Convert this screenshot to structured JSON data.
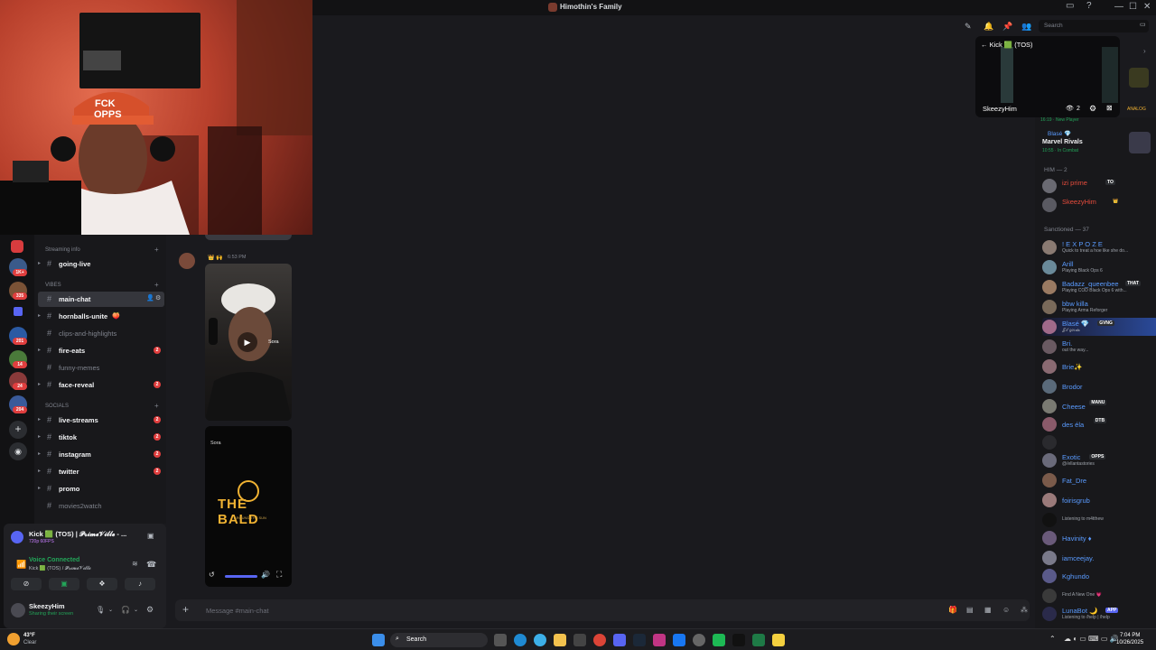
{
  "window": {
    "title": "Himothin's Family",
    "min": "—",
    "max": "☐",
    "close": "✕"
  },
  "server_badges": [
    "1K+",
    "335",
    "201",
    "14",
    "24",
    "204"
  ],
  "channels": {
    "categories": {
      "streaming_info": "Streaming info",
      "vibes": "VIBES",
      "socials": "SOCIALS"
    },
    "items": [
      {
        "name": "going-live",
        "muted": false,
        "badge": ""
      },
      {
        "name": "main-chat",
        "muted": false,
        "badge": ""
      },
      {
        "name": "hornballs-unite",
        "muted": false,
        "badge": ""
      },
      {
        "name": "clips-and-highlights",
        "muted": true,
        "badge": ""
      },
      {
        "name": "fire-eats",
        "muted": false,
        "badge": "2"
      },
      {
        "name": "funny-memes",
        "muted": true,
        "badge": ""
      },
      {
        "name": "face-reveal",
        "muted": false,
        "badge": "2"
      },
      {
        "name": "live-streams",
        "muted": false,
        "badge": "2"
      },
      {
        "name": "tiktok",
        "muted": false,
        "badge": "2"
      },
      {
        "name": "instagram",
        "muted": false,
        "badge": "2"
      },
      {
        "name": "twitter",
        "muted": false,
        "badge": "2"
      },
      {
        "name": "promo",
        "muted": false,
        "badge": ""
      },
      {
        "name": "movies2watch",
        "muted": true,
        "badge": ""
      }
    ]
  },
  "voice": {
    "channel": "Kick 🟩 (TOS) | 𝓟𝓻𝓲𝓶𝓮𝓥𝓲𝓵𝓵𝓮 - ...",
    "sub": "720p 60FPS",
    "status": "Voice Connected",
    "status_sub": "Kick 🟩 (TOS) / 𝓟𝓻𝓲𝓶𝓮𝓥𝓲𝓵𝓵𝓮",
    "user": "SkeezyHim",
    "user_status": "Sharing their screen"
  },
  "chat": {
    "timestamp": "6:53 PM",
    "sora_label": "Sora",
    "sora_label2": "Sora",
    "the_bald": "THE BALD",
    "bald_sub": "AROUND THE SUN",
    "placeholder": "Message #main-chat",
    "plus": "+"
  },
  "header": {
    "search_placeholder": "Search"
  },
  "preview": {
    "title": "Kick 🟩 (TOS)",
    "user": "SkeezyHim",
    "viewers": "2"
  },
  "members": {
    "partial_status": "16:19 · New Player",
    "blase_top": {
      "name": "Blasé 💎",
      "game": "Marvel Rivals",
      "status": "10:55 · In Combat"
    },
    "him_group": "HIM — 2",
    "him": [
      {
        "name": "izi prime",
        "color": "#e74c3c",
        "tag": "TO"
      },
      {
        "name": "SkeezyHim",
        "color": "#e74c3c",
        "tag": "👑"
      }
    ],
    "sanctioned_group": "Sanctioned — 37",
    "sanctioned": [
      {
        "name": "! E X P O Z E",
        "status": "Quick to treat a hoe like she do...",
        "tag": ""
      },
      {
        "name": "Arill",
        "status": "Playing Black Ops 6",
        "tag": ""
      },
      {
        "name": "Badazz_queenbee",
        "status": "Playing COD Black Ops 6 with...",
        "tag": "THAT"
      },
      {
        "name": "bbw killa",
        "status": "Playing Arma Reforger",
        "tag": ""
      },
      {
        "name": "Blasé 💎",
        "status": "𝒥𝒾𝓁 𝑔𝑜𝓇𝒹𝒶",
        "tag": "GVNG"
      },
      {
        "name": "Bri.",
        "status": "out the way...",
        "tag": ""
      },
      {
        "name": "Brie✨",
        "status": "",
        "tag": ""
      },
      {
        "name": "Brodor",
        "status": "",
        "tag": ""
      },
      {
        "name": "Cheese",
        "status": "",
        "tag": "MANU"
      },
      {
        "name": "des éla",
        "status": "",
        "tag": "DTB"
      },
      {
        "name": "",
        "status": "",
        "tag": ""
      },
      {
        "name": "Exotic",
        "status": "@/ellantastories",
        "tag": "OPPS"
      },
      {
        "name": "Fat_Dre",
        "status": "",
        "tag": ""
      },
      {
        "name": "foirisgrub",
        "status": "",
        "tag": ""
      },
      {
        "name": "",
        "status": "Listening to m4tthew",
        "tag": ""
      },
      {
        "name": "Havinity ♦",
        "status": "",
        "tag": ""
      },
      {
        "name": "iamceejay.",
        "status": "",
        "tag": ""
      },
      {
        "name": "Kghundo",
        "status": "",
        "tag": ""
      },
      {
        "name": "",
        "status": "Find A New One 💗",
        "tag": ""
      },
      {
        "name": "LunaBot 🌙",
        "status": "Listening to /help | /help",
        "tag": "APP"
      }
    ]
  },
  "taskbar": {
    "weather_temp": "43°F",
    "weather_desc": "Clear",
    "search": "Search",
    "time": "7:04 PM",
    "date": "10/26/2025"
  }
}
